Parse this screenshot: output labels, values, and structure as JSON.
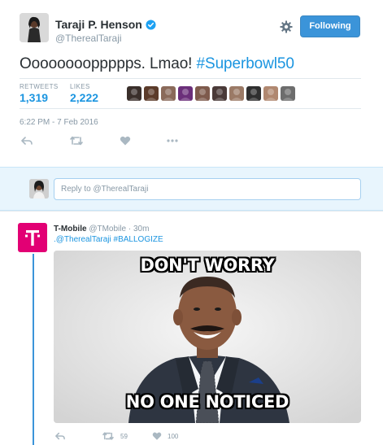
{
  "tweet": {
    "author_name": "Taraji P. Henson",
    "author_handle": "@TherealTaraji",
    "follow_label": "Following",
    "text": "Ooooooooppppps. Lmao! ",
    "hashtag": "#Superbowl50",
    "retweets_label": "RETWEETS",
    "retweets_count": "1,319",
    "likes_label": "LIKES",
    "likes_count": "2,222",
    "timestamp": "6:22 PM - 7 Feb 2016",
    "liker_colors": [
      "#3a2f2b",
      "#5b3b2a",
      "#8a6a5a",
      "#6b2f7a",
      "#7e5a4c",
      "#4a3a38",
      "#9b7a66",
      "#2f2f2f",
      "#b08870",
      "#6d6d6d"
    ]
  },
  "reply_bar": {
    "placeholder": "Reply to @TherealTaraji"
  },
  "reply_tweet": {
    "author_name": "T-Mobile",
    "author_handle": "@TMobile",
    "time": "30m",
    "mention": ".@TherealTaraji",
    "hashtag": "#BALLOGIZE",
    "meme_top": "DON'T WORRY",
    "meme_bottom": "NO ONE NOTICED",
    "retweets": "59",
    "likes": "100"
  },
  "colors": {
    "accent": "#1b95e0",
    "follow_button": "#3b94d9",
    "tmobile_magenta": "#e20074",
    "muted": "#8899a6"
  }
}
